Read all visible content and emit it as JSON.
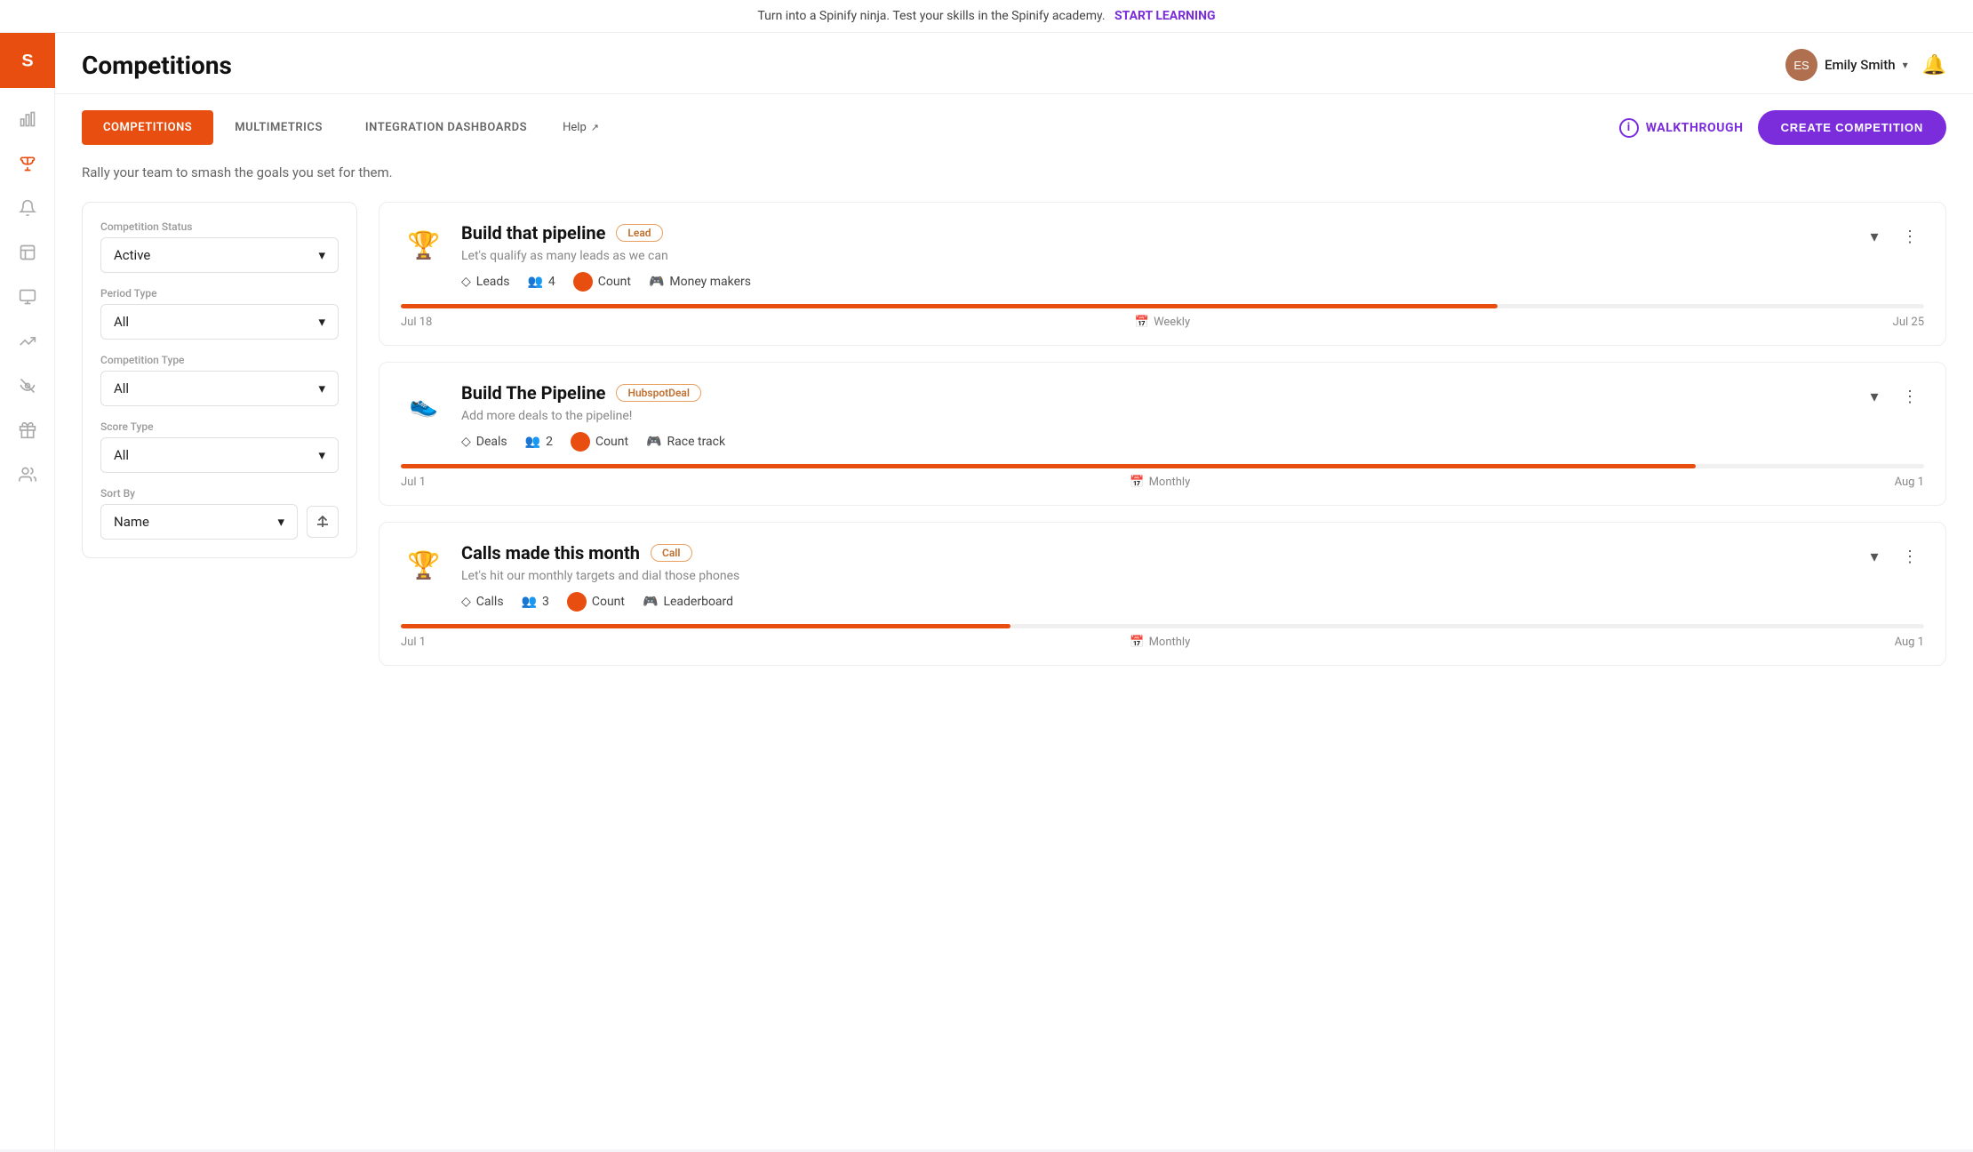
{
  "banner": {
    "text": "Turn into a Spinify ninja. Test your skills in the Spinify academy.",
    "cta": "START LEARNING"
  },
  "header": {
    "title": "Competitions",
    "user": {
      "name": "Emily Smith",
      "avatar_initials": "ES"
    },
    "bell_label": "notifications"
  },
  "tabs": [
    {
      "id": "competitions",
      "label": "COMPETITIONS",
      "active": true
    },
    {
      "id": "multimetrics",
      "label": "MULTIMETRICS",
      "active": false
    },
    {
      "id": "integration-dashboards",
      "label": "INTEGRATION DASHBOARDS",
      "active": false
    }
  ],
  "help_label": "Help",
  "walkthrough_label": "WALKTHROUGH",
  "create_btn_label": "CREATE COMPETITION",
  "subtitle": "Rally your team to smash the goals you set for them.",
  "filters": {
    "competition_status": {
      "label": "Competition Status",
      "value": "Active"
    },
    "period_type": {
      "label": "Period Type",
      "value": "All"
    },
    "competition_type": {
      "label": "Competition Type",
      "value": "All"
    },
    "score_type": {
      "label": "Score Type",
      "value": "All"
    },
    "sort_by": {
      "label": "Sort By",
      "value": "Name"
    }
  },
  "competitions": [
    {
      "id": 1,
      "icon": "🏆",
      "title": "Build that pipeline",
      "badge": "Lead",
      "badge_type": "lead",
      "description": "Let's qualify as many leads as we can",
      "metric": "Leads",
      "metric_icon": "diamond",
      "participants": "4",
      "score_label": "Count",
      "display_label": "Money makers",
      "progress": 72,
      "start_date": "Jul 18",
      "period": "Weekly",
      "end_date": "Jul 25"
    },
    {
      "id": 2,
      "icon": "👟",
      "title": "Build The Pipeline",
      "badge": "HubspotDeal",
      "badge_type": "hubspot",
      "description": "Add more deals to the pipeline!",
      "metric": "Deals",
      "metric_icon": "diamond",
      "participants": "2",
      "score_label": "Count",
      "display_label": "Race track",
      "progress": 85,
      "start_date": "Jul 1",
      "period": "Monthly",
      "end_date": "Aug 1"
    },
    {
      "id": 3,
      "icon": "🏆",
      "title": "Calls made this month",
      "badge": "Call",
      "badge_type": "call",
      "description": "Let's hit our monthly targets and dial those phones",
      "metric": "Calls",
      "metric_icon": "diamond",
      "participants": "3",
      "score_label": "Count",
      "display_label": "Leaderboard",
      "progress": 40,
      "start_date": "Jul 1",
      "period": "Monthly",
      "end_date": "Aug 1"
    }
  ],
  "sidebar_icons": [
    {
      "id": "chart-bar",
      "icon": "📊",
      "label": "Analytics"
    },
    {
      "id": "trophy",
      "icon": "🏆",
      "label": "Competitions",
      "active": true
    },
    {
      "id": "megaphone",
      "icon": "📣",
      "label": "Announcements"
    },
    {
      "id": "table",
      "icon": "📋",
      "label": "Reports"
    },
    {
      "id": "monitor",
      "icon": "🖥",
      "label": "Display"
    },
    {
      "id": "trend",
      "icon": "📈",
      "label": "Trends"
    },
    {
      "id": "eye",
      "icon": "👁",
      "label": "Watch"
    },
    {
      "id": "gift",
      "icon": "🎁",
      "label": "Rewards"
    },
    {
      "id": "person",
      "icon": "👤",
      "label": "Team"
    }
  ]
}
